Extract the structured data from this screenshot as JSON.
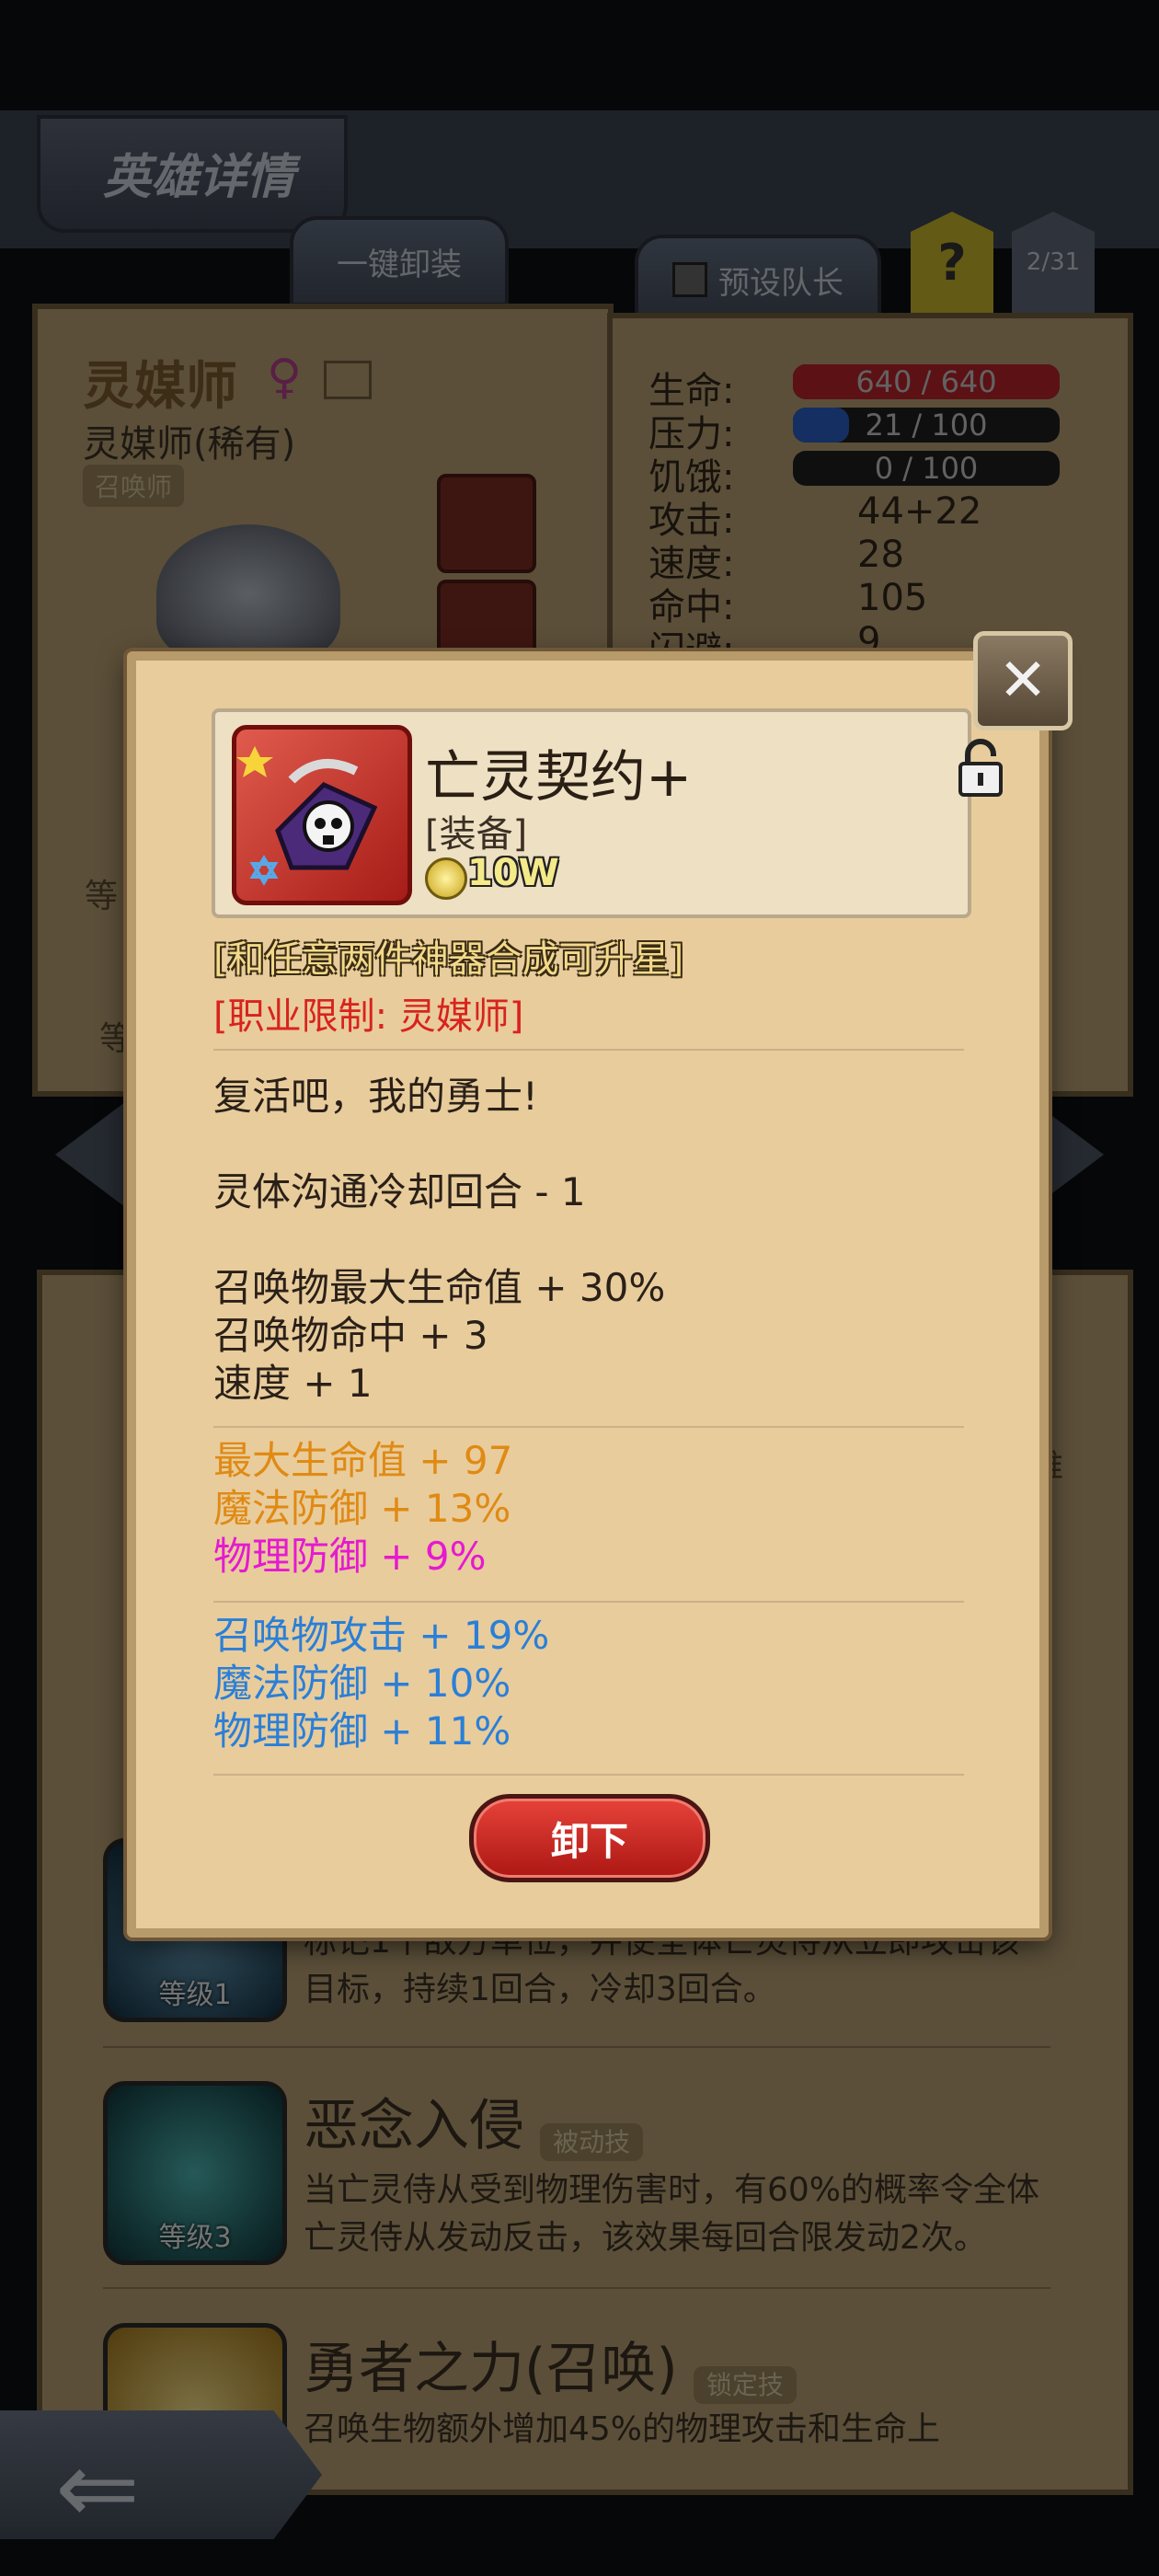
{
  "background": {
    "title": "英雄详情",
    "tabs": {
      "unequip_all": "一键卸装",
      "preset_leader": "预设队长",
      "help": "?",
      "count": "2/31"
    },
    "hero": {
      "name": "灵媒师",
      "subtitle": "灵媒师(稀有)",
      "class_tag": "召唤师"
    },
    "stats": [
      {
        "label": "生命:",
        "value": "640 / 640",
        "kind": "bar",
        "color": "#b8232a",
        "fill": 1.0
      },
      {
        "label": "压力:",
        "value": "21 / 100",
        "kind": "bar",
        "color": "#2b5fc4",
        "fill": 0.21
      },
      {
        "label": "饥饿:",
        "value": "0 / 100",
        "kind": "bar",
        "color": "#555555",
        "fill": 0.0
      },
      {
        "label": "攻击:",
        "value": "44+22",
        "kind": "text"
      },
      {
        "label": "速度:",
        "value": "28",
        "kind": "text"
      },
      {
        "label": "命中:",
        "value": "105",
        "kind": "text"
      },
      {
        "label": "闪避:",
        "value": "9",
        "kind": "text"
      }
    ],
    "side_labels": {
      "level_left": "等",
      "level_left2": "等",
      "right_fragment": "难"
    },
    "skills": [
      {
        "level": "等级1",
        "desc": "标记1个敌方单位，并使全体亡灵侍从立即攻击该目标，持续1回合，冷却3回合。"
      },
      {
        "level": "等级3",
        "title": "恶念入侵",
        "tag": "被动技",
        "desc": "当亡灵侍从受到物理伤害时，有60%的概率令全体亡灵侍从发动反击，该效果每回合限发动2次。"
      },
      {
        "title": "勇者之力(召唤)",
        "tag": "锁定技",
        "desc": "召唤生物额外增加45%的物理攻击和生命上"
      }
    ]
  },
  "modal": {
    "item_name": "亡灵契约+",
    "item_type": "[装备]",
    "price": "10W",
    "hint_upgrade": "[和任意两件神器合成可升星]",
    "class_restriction": "[职业限制: 灵媒师]",
    "flavor": "复活吧，我的勇士!",
    "effect_lines_1": [
      "灵体沟通冷却回合 - 1"
    ],
    "effect_lines_2": [
      "召唤物最大生命值 + 30%",
      "召唤物命中 + 3",
      "速度 + 1"
    ],
    "bonus_orange": [
      "最大生命值 + 97",
      "魔法防御 + 13%"
    ],
    "bonus_magenta": [
      "物理防御 + 9%"
    ],
    "bonus_blue": [
      "召唤物攻击 + 19%",
      "魔法防御 + 10%",
      "物理防御 + 11%"
    ],
    "unequip_label": "卸下",
    "close_icon": "crossed-swords-icon",
    "colors": {
      "orange": "#e08a14",
      "magenta": "#e51ad0",
      "blue": "#2a7fd8",
      "red": "#d8231e"
    }
  }
}
